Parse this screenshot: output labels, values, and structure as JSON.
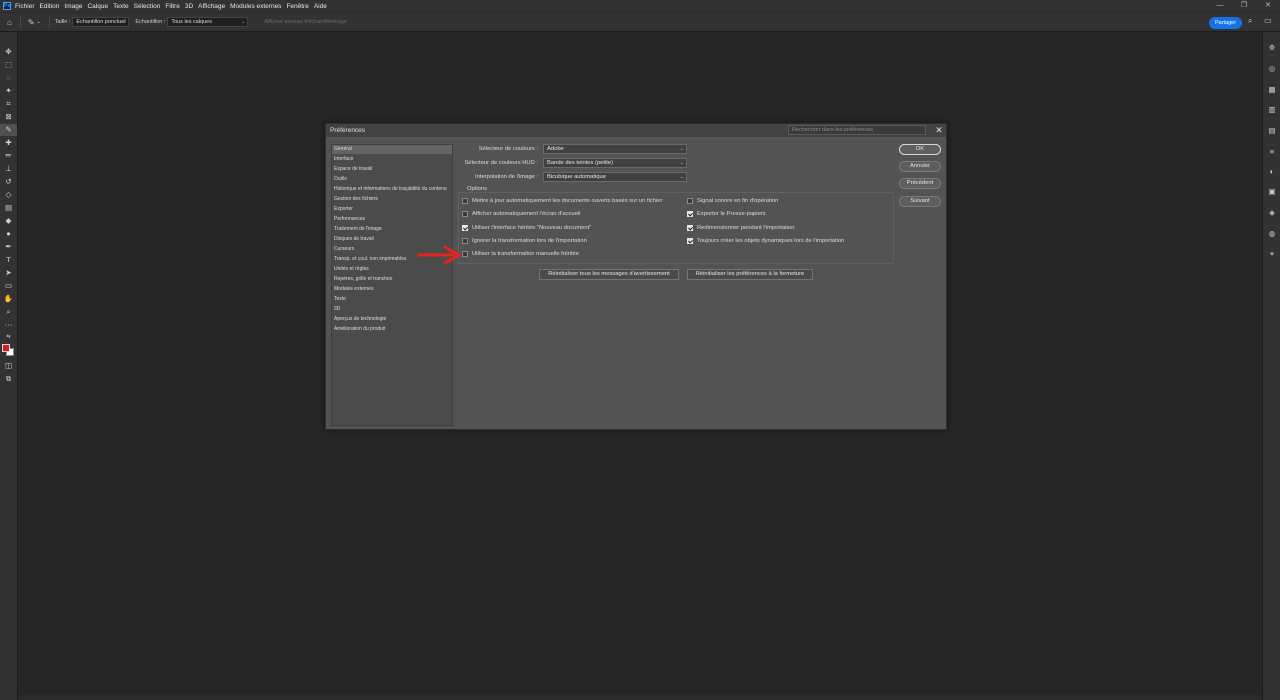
{
  "menubar": {
    "logo": "Ps",
    "items": [
      "Fichier",
      "Edition",
      "Image",
      "Calque",
      "Texte",
      "Sélection",
      "Filtre",
      "3D",
      "Affichage",
      "Modules externes",
      "Fenêtre",
      "Aide"
    ],
    "window_controls": [
      "—",
      "❐",
      "✕"
    ]
  },
  "options_bar": {
    "home_icon": "home-icon",
    "tool_icon": "eyedropper-icon",
    "size_label": "Taille :",
    "size_value": "Echantillon ponctuel",
    "sample_label": "Echantillon :",
    "sample_value": "Tous les calques",
    "show_ring_label": "Afficher anneau d'échantillonnage",
    "share_label": "Partager"
  },
  "dialog": {
    "title": "Préférences",
    "search_placeholder": "Rechercher dans les préférences",
    "categories": [
      "Général",
      "Interface",
      "Espace de travail",
      "Outils",
      "Historique et informations de traçabilité du contenu",
      "Gestion des fichiers",
      "Exporter",
      "Performances",
      "Traitement de l'image",
      "Disques de travail",
      "Curseurs",
      "Transp. et coul. non imprimables",
      "Unités et règles",
      "Repères, grille et tranches",
      "Modules externes",
      "Texte",
      "3D",
      "Aperçus de technologie",
      "Amélioration du produit"
    ],
    "selected_category": 0,
    "fields": {
      "color_picker_label": "Sélecteur de couleurs :",
      "color_picker_value": "Adobe",
      "hud_picker_label": "Sélecteur de couleurs HUD :",
      "hud_picker_value": "Bande des teintes (petite)",
      "interp_label": "Interpolation de l'image :",
      "interp_value": "Bicubique automatique"
    },
    "options_title": "Options",
    "options": [
      {
        "label": "Mettre à jour automatiquement les documents ouverts basés sur un fichier",
        "checked": false
      },
      {
        "label": "Afficher automatiquement l'écran d'accueil",
        "checked": false
      },
      {
        "label": "Utiliser l'interface héritée \"Nouveau document\"",
        "checked": true
      },
      {
        "label": "Ignorer la transformation lors de l'importation",
        "checked": false
      },
      {
        "label": "Utiliser la transformation manuelle héritée",
        "checked": false
      },
      {
        "label": "Signal sonore en fin d'opération",
        "checked": false
      },
      {
        "label": "Exporter le Presse-papiers",
        "checked": true
      },
      {
        "label": "Redimensionner pendant l'importation",
        "checked": true
      },
      {
        "label": "Toujours créer les objets dynamiques lors de l'importation",
        "checked": true
      }
    ],
    "reset_warnings_label": "Réinitialiser tous les messages d'avertissement",
    "reset_prefs_label": "Réinitialiser les préférences à la fermeture",
    "buttons": {
      "ok": "OK",
      "cancel": "Annuler",
      "previous": "Précédent",
      "next": "Suivant"
    }
  },
  "annotation": {
    "arrow_color": "#e8231c"
  },
  "colors": {
    "foreground": "#e01818",
    "background": "#ffffff",
    "accent": "#1473e6"
  }
}
